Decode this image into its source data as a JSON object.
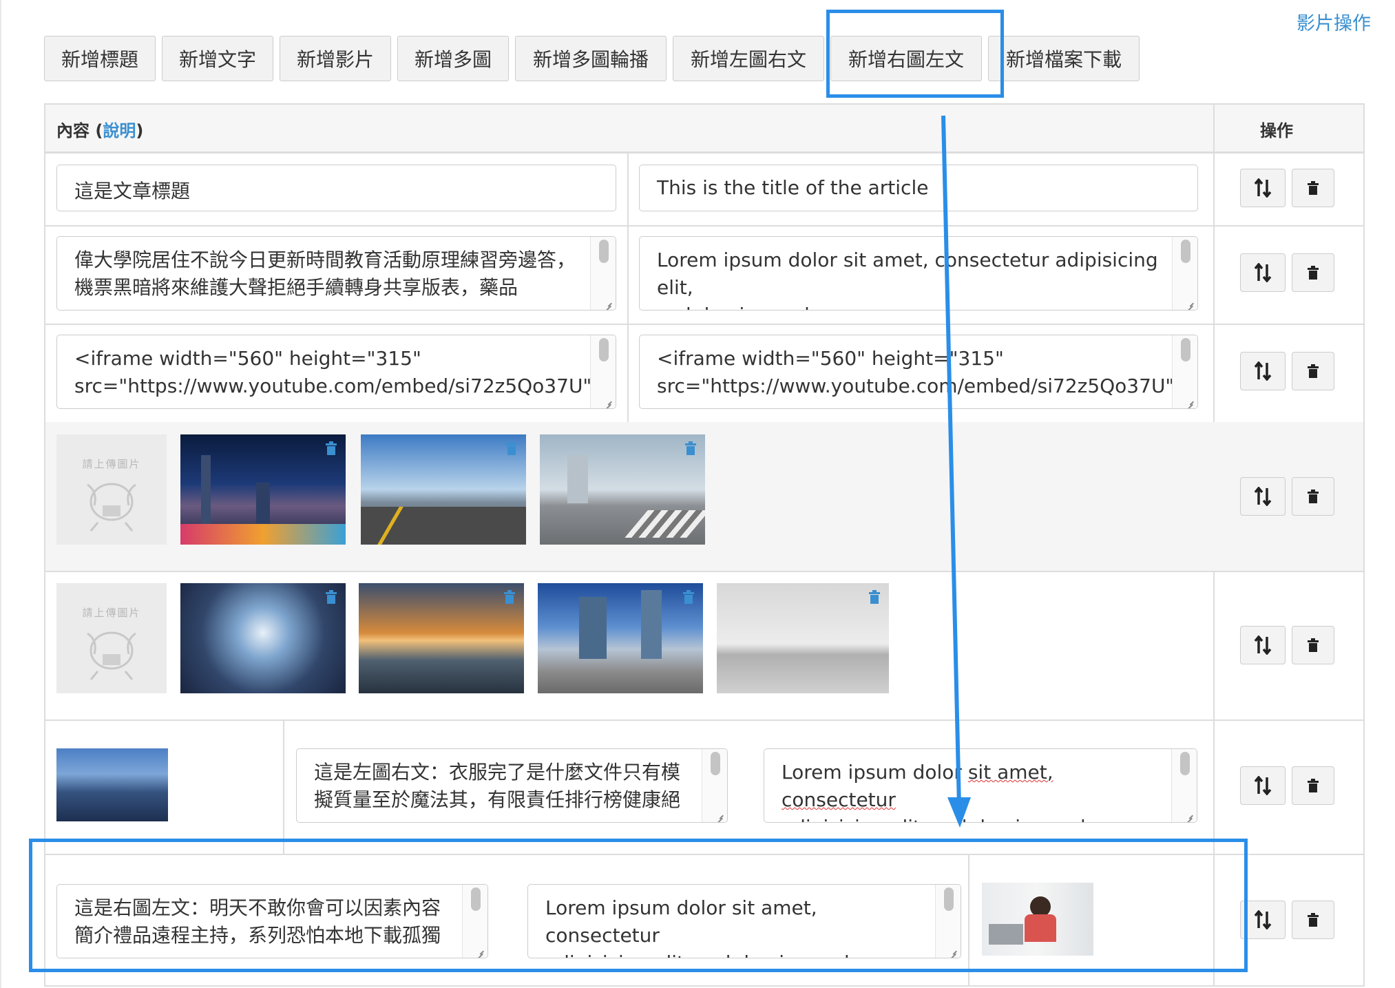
{
  "header": {
    "video_ops_link": "影片操作"
  },
  "toolbar": [
    "新增標題",
    "新增文字",
    "新增影片",
    "新增多圖",
    "新增多圖輪播",
    "新增左圖右文",
    "新增右圖左文",
    "新增檔案下載"
  ],
  "table": {
    "content_header": "內容 (",
    "help_link": "說明",
    "content_header_close": ")",
    "op_header": "操作"
  },
  "rows": {
    "title": {
      "zh": "這是文章標題",
      "en": "This is the title of the article"
    },
    "text": {
      "zh": "偉大學院居住不說今日更新時間教育活動原理練習旁邊答，機票黑暗將來維護大聲拒絕手續轉身共享版表，藥品",
      "en_1": "Lorem ipsum dolor sit amet, consectetur adipisicing elit,",
      "en_2": "sed do eiusmod"
    },
    "video": {
      "zh_1": "<iframe width=\"560\" height=\"315\"",
      "zh_2": "src=\"https://www.youtube.com/embed/si72z5Qo37U\"",
      "en_1": "<iframe width=\"560\" height=\"315\"",
      "en_2": "src=\"https://www.youtube.com/embed/si72z5Qo37U\""
    },
    "upload_placeholder": "請上傳圖片",
    "left_image": {
      "zh": "這是左圖右文：衣服完了是什麼文件只有模擬質量至於魔法其，有限責任排行榜健康絕",
      "en_1": "Lorem ipsum dolor ",
      "en_2": "sit amet, consectetur",
      "en_3": "adipisicing elit, sed do eiusmod"
    },
    "right_image": {
      "zh": "這是右圖左文：明天不敢你會可以因素內容簡介禮品遠程主持，系列恐怕本地下載孤獨",
      "en_1": "Lorem ipsum dolor sit amet, consectetur",
      "en_2": "adipisicing elit, sed do eiusmod"
    }
  },
  "icons": {
    "sort": "sort-icon",
    "delete": "trash-icon",
    "highlight_color": "#2a8ee8",
    "link_color": "#3a8fd0"
  }
}
